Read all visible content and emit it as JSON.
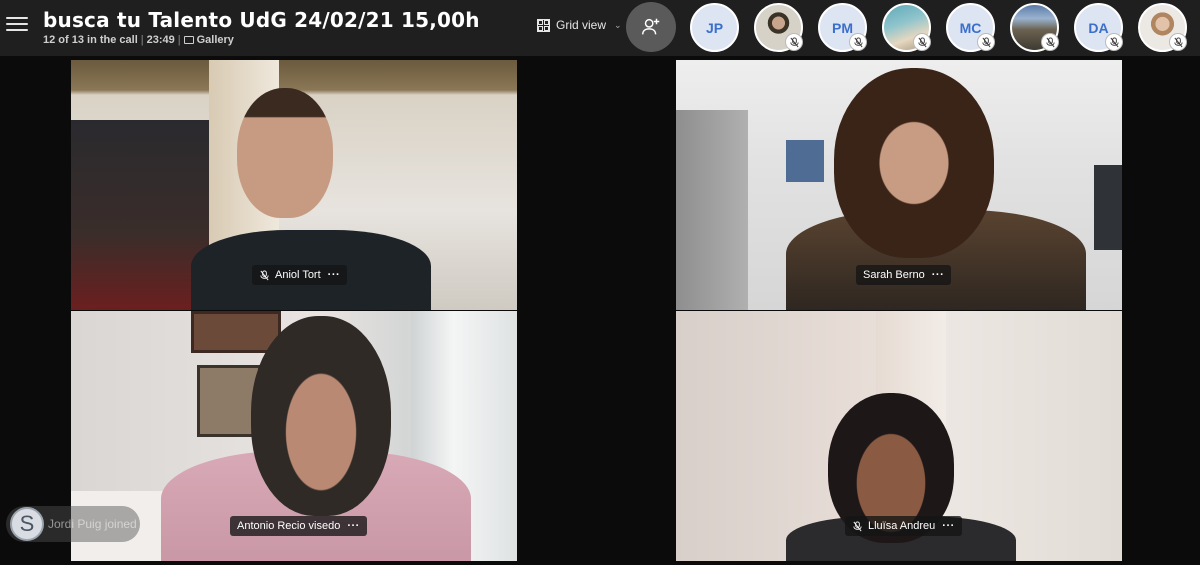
{
  "header": {
    "title": "busca tu Talento UdG 24/02/21 15,00h",
    "participants": "12 of 13 in the call",
    "elapsed": "23:49",
    "layout_name": "Gallery"
  },
  "view_switcher": {
    "label": "Grid view"
  },
  "participant_strip": [
    {
      "initials": "JP",
      "muted": false
    },
    {
      "photo": true,
      "muted": true
    },
    {
      "initials": "PM",
      "muted": true
    },
    {
      "photo": true,
      "muted": true
    },
    {
      "initials": "MC",
      "muted": true
    },
    {
      "photo": true,
      "muted": true
    },
    {
      "initials": "DA",
      "muted": true
    },
    {
      "photo": true,
      "muted": true
    }
  ],
  "tiles": [
    {
      "name": "Aniol Tort",
      "muted": true,
      "more": "···"
    },
    {
      "name": "Sarah Berno",
      "muted": false,
      "more": "···"
    },
    {
      "name": "Antonio Recio visedo",
      "muted": false,
      "more": "···"
    },
    {
      "name": "Lluïsa Andreu",
      "muted": true,
      "more": "···"
    }
  ],
  "toast": {
    "badge": "S",
    "text": "Jordi Puig joined"
  },
  "colors": {
    "header_bg": "#1f1f1f",
    "initials_text": "#3a6fcc",
    "initials_bg": "#dde5f3",
    "add_button_bg": "#5a5a5a"
  }
}
